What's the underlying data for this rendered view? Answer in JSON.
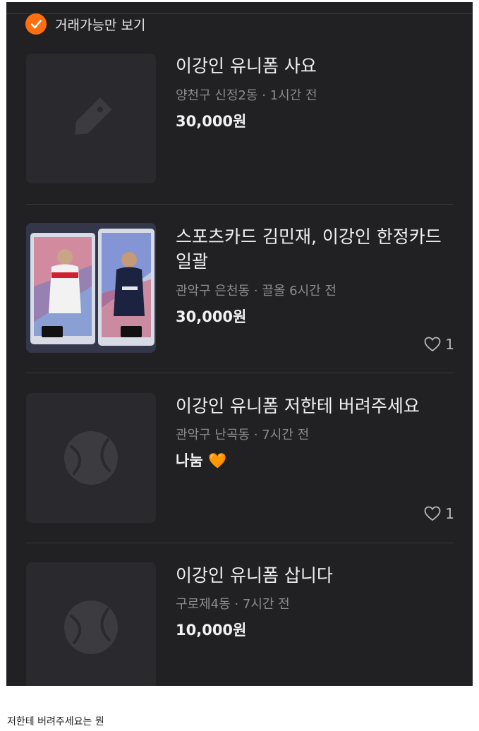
{
  "filter": {
    "label": "거래가능만 보기",
    "checked": true
  },
  "items": [
    {
      "title": "이강인 유니폼 사요",
      "location": "양천구 신정2동",
      "time": "1시간 전",
      "price": "30,000원",
      "likes": ""
    },
    {
      "title": "스포츠카드 김민재, 이강인 한정카드 일괄",
      "location": "관악구 은천동",
      "time": "끌올 6시간 전",
      "price": "30,000원",
      "likes": "1"
    },
    {
      "title": "이강인 유니폼 저한테 버려주세요",
      "location": "관악구 난곡동",
      "time": "7시간 전",
      "price": "나눔 🧡",
      "likes": "1"
    },
    {
      "title": "이강인 유니폼 삽니다",
      "location": "구로제4동",
      "time": "7시간 전",
      "price": "10,000원",
      "likes": ""
    }
  ],
  "caption": "저한테 버려주세요는 뭔"
}
